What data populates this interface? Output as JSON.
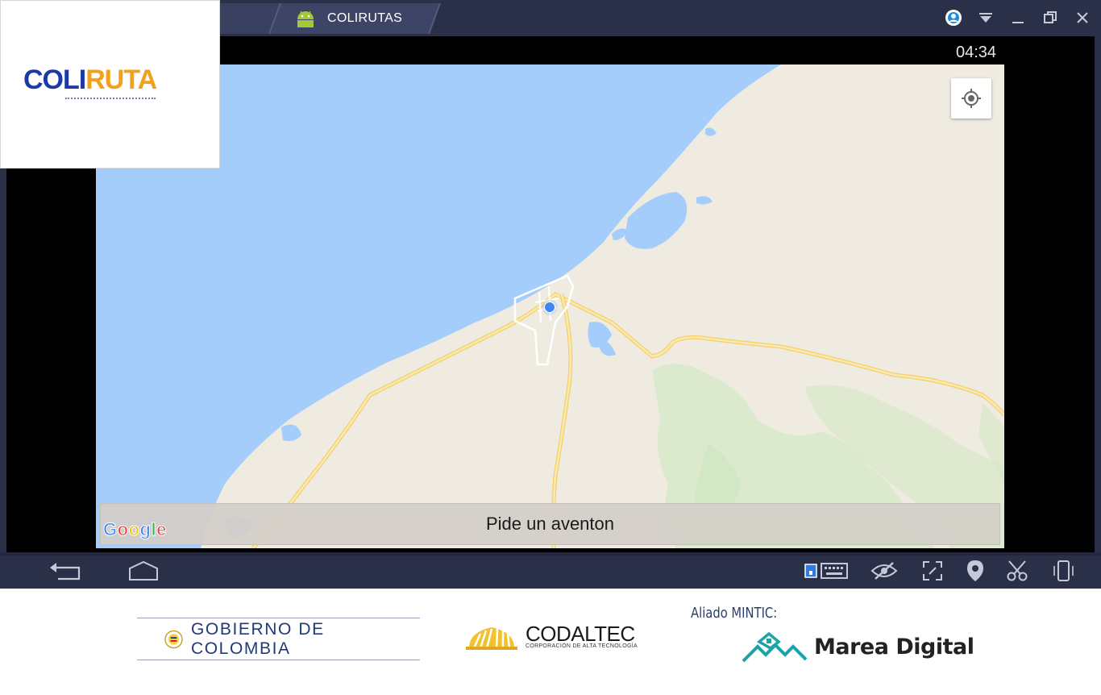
{
  "emulator": {
    "tab_title": "COLIRUTAS",
    "status_time": "04:34",
    "window_buttons": [
      "account-icon",
      "dropdown-icon",
      "minimize-icon",
      "restore-icon",
      "close-icon"
    ],
    "nav_buttons": [
      "back-icon",
      "home-icon"
    ],
    "toolbar_buttons": [
      "keyboard-icon",
      "visibility-icon",
      "fullscreen-icon",
      "location-icon",
      "scissors-icon",
      "rotate-device-icon"
    ]
  },
  "app_logo": {
    "part1": "COLI",
    "part2": "RUTA",
    "colors": {
      "blue": "#1c3aa6",
      "orange": "#f2a11a"
    }
  },
  "map": {
    "provider_logo": "Google",
    "locate_button": "my-location-icon",
    "action_button_label": "Pide un aventon",
    "colors": {
      "water": "#a4cdfb",
      "land": "#efebe1",
      "road": "#f6d97a",
      "vegetation": "#d4e8c5",
      "user_dot": "#4285f4"
    }
  },
  "footer": {
    "government": "GOBIERNO DE COLOMBIA",
    "codaltec_name": "CODALTEC",
    "codaltec_subtitle": "CORPORACIÓN DE ALTA TECNOLOGÍA",
    "ally_label": "Aliado MINTIC:",
    "ally_name": "Marea Digital"
  }
}
